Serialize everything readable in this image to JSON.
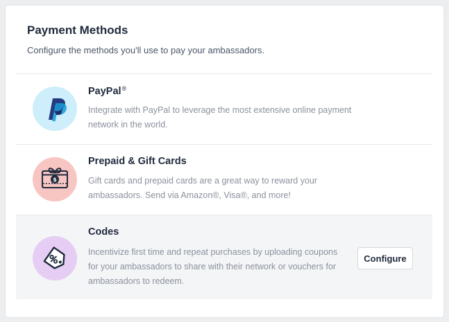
{
  "header": {
    "title": "Payment Methods",
    "subtitle": "Configure the methods you'll use to pay your ambassadors."
  },
  "methods": [
    {
      "title": "PayPal",
      "title_mark": "®",
      "description": "Integrate with PayPal to leverage the most extensive online payment network in the world.",
      "icon": "paypal-icon",
      "icon_bg": "#cdeefa"
    },
    {
      "title": "Prepaid & Gift Cards",
      "description": "Gift cards and prepaid cards are a great way to reward your ambassadors. Send via Amazon®, Visa®, and more!",
      "icon": "gift-card-icon",
      "icon_bg": "#f8c6c2"
    },
    {
      "title": "Codes",
      "description": "Incentivize first time and repeat purchases by uploading coupons for your ambassadors to share with their network or vouchers for ambassadors to redeem.",
      "icon": "coupon-tag-icon",
      "icon_bg": "#e6cdf3",
      "button_label": "Configure"
    }
  ],
  "colors": {
    "text_primary": "#1f2a3c",
    "text_muted": "#8a919c",
    "active_row_bg": "#f4f5f7"
  }
}
